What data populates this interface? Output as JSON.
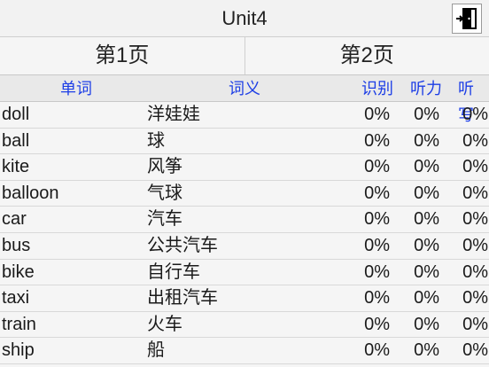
{
  "window": {
    "title": "Unit4",
    "exit_icon": "exit-door-icon"
  },
  "pages": [
    {
      "label": "第1页"
    },
    {
      "label": "第2页"
    }
  ],
  "columns": {
    "word": "单词",
    "meaning": "词义",
    "recognize": "识别",
    "listen": "听力",
    "write": "听写"
  },
  "rows": [
    {
      "word": "doll",
      "meaning": "洋娃娃",
      "recognize": "0%",
      "listen": "0%",
      "write": "0%"
    },
    {
      "word": "ball",
      "meaning": "球",
      "recognize": "0%",
      "listen": "0%",
      "write": "0%"
    },
    {
      "word": "kite",
      "meaning": "风筝",
      "recognize": "0%",
      "listen": "0%",
      "write": "0%"
    },
    {
      "word": "balloon",
      "meaning": "气球",
      "recognize": "0%",
      "listen": "0%",
      "write": "0%"
    },
    {
      "word": "car",
      "meaning": "汽车",
      "recognize": "0%",
      "listen": "0%",
      "write": "0%"
    },
    {
      "word": "bus",
      "meaning": "公共汽车",
      "recognize": "0%",
      "listen": "0%",
      "write": "0%"
    },
    {
      "word": "bike",
      "meaning": "自行车",
      "recognize": "0%",
      "listen": "0%",
      "write": "0%"
    },
    {
      "word": "taxi",
      "meaning": "出租汽车",
      "recognize": "0%",
      "listen": "0%",
      "write": "0%"
    },
    {
      "word": "train",
      "meaning": "火车",
      "recognize": "0%",
      "listen": "0%",
      "write": "0%"
    },
    {
      "word": "ship",
      "meaning": "船",
      "recognize": "0%",
      "listen": "0%",
      "write": "0%"
    }
  ],
  "colors": {
    "header_text": "#1d3ee6",
    "background": "#f5f5f5"
  }
}
